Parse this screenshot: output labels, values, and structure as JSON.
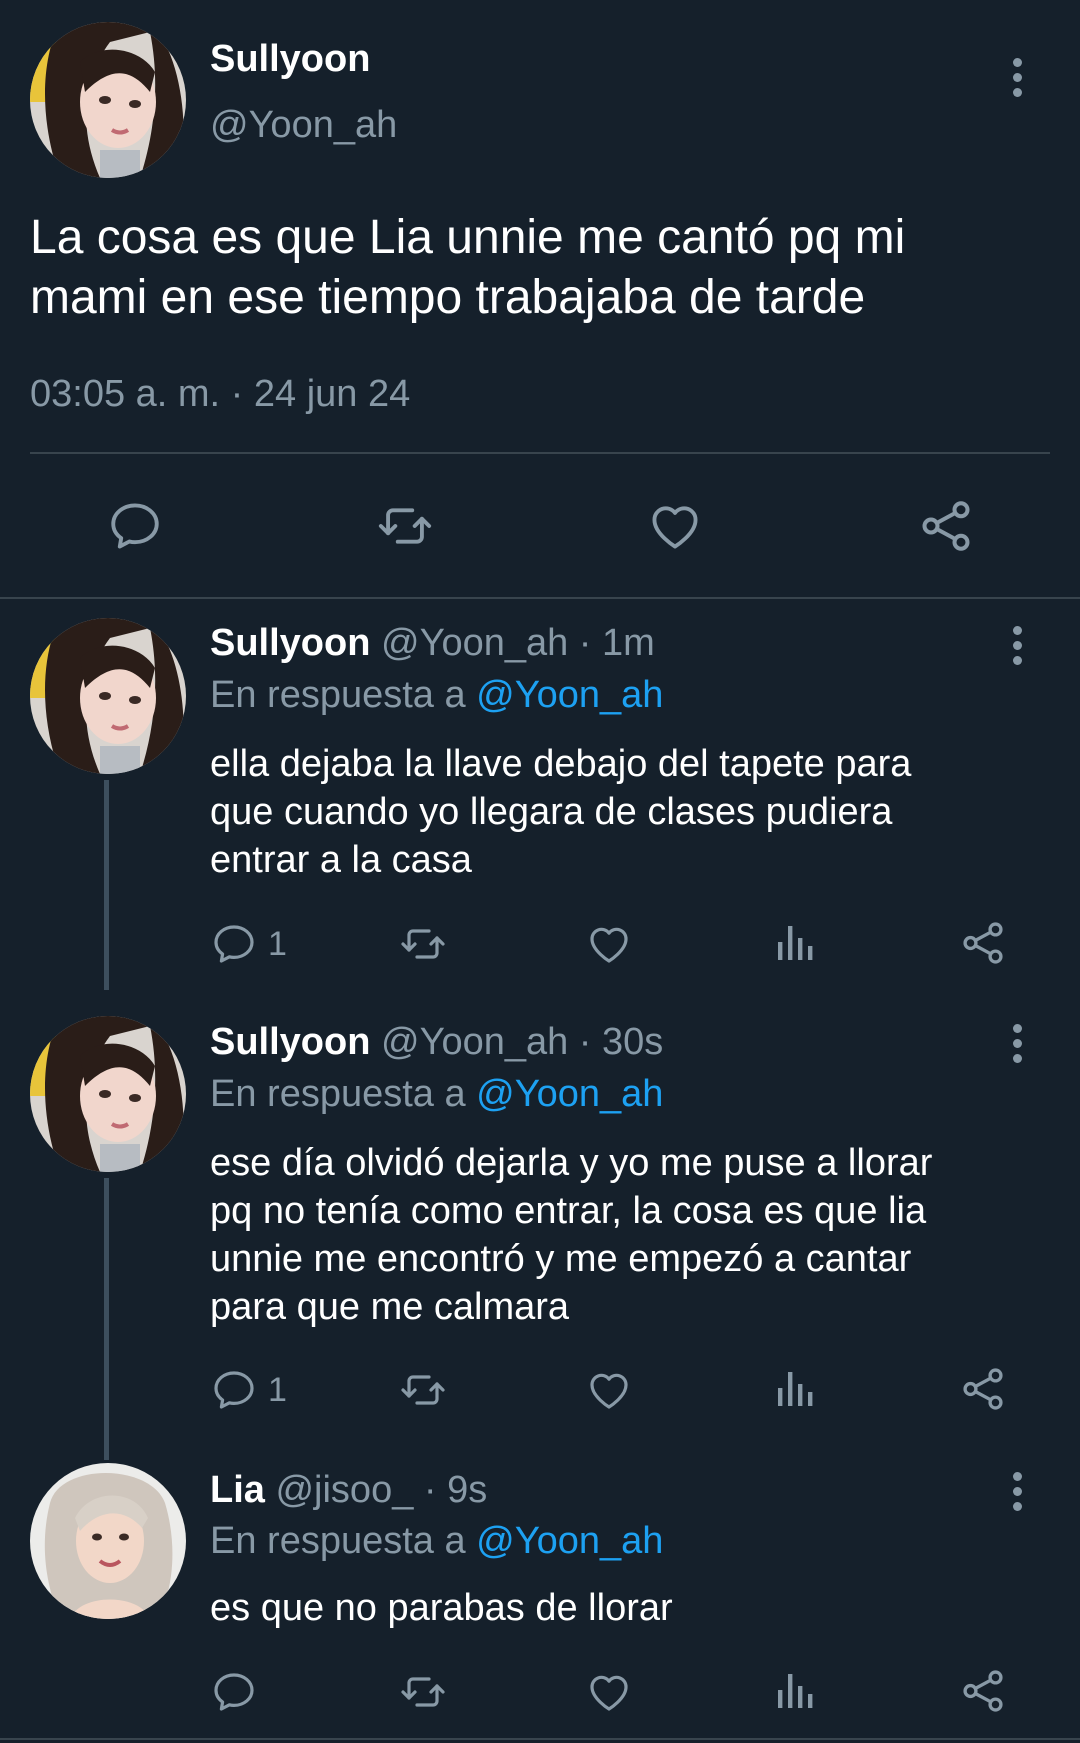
{
  "main_tweet": {
    "name": "Sullyoon",
    "handle": "@Yoon_ah",
    "text_line1": "La cosa es que Lia unnie me cantó pq mi",
    "text_line2": "mami en ese tiempo trabajaba de tarde",
    "timestamp": "03:05 a. m. · 24 jun 24"
  },
  "replies": [
    {
      "name": "Sullyoon",
      "meta": "@Yoon_ah · 1m",
      "reply_prefix": "En respuesta a",
      "reply_to": "@Yoon_ah",
      "lines": [
        "ella dejaba la llave debajo del tapete para",
        "que cuando yo llegara de clases pudiera",
        "entrar a la casa"
      ],
      "reply_count": "1"
    },
    {
      "name": "Sullyoon",
      "meta": "@Yoon_ah · 30s",
      "reply_prefix": "En respuesta a",
      "reply_to": "@Yoon_ah",
      "lines": [
        "ese día olvidó dejarla y yo me puse a llorar",
        "pq no tenía como entrar, la cosa es que lia",
        "unnie me encontró y me empezó a cantar",
        "para que me calmara"
      ],
      "reply_count": "1"
    },
    {
      "name": "Lia",
      "meta": "@jisoo_ · 9s",
      "reply_prefix": "En respuesta a",
      "reply_to": "@Yoon_ah",
      "lines": [
        "es que no parabas de llorar"
      ],
      "reply_count": ""
    }
  ],
  "colors": {
    "background": "#15202b",
    "muted": "#8899a6",
    "link": "#1da1f2",
    "divider": "#38444d"
  },
  "icons": [
    "reply-icon",
    "retweet-icon",
    "like-icon",
    "share-icon",
    "views-icon",
    "more-icon"
  ]
}
